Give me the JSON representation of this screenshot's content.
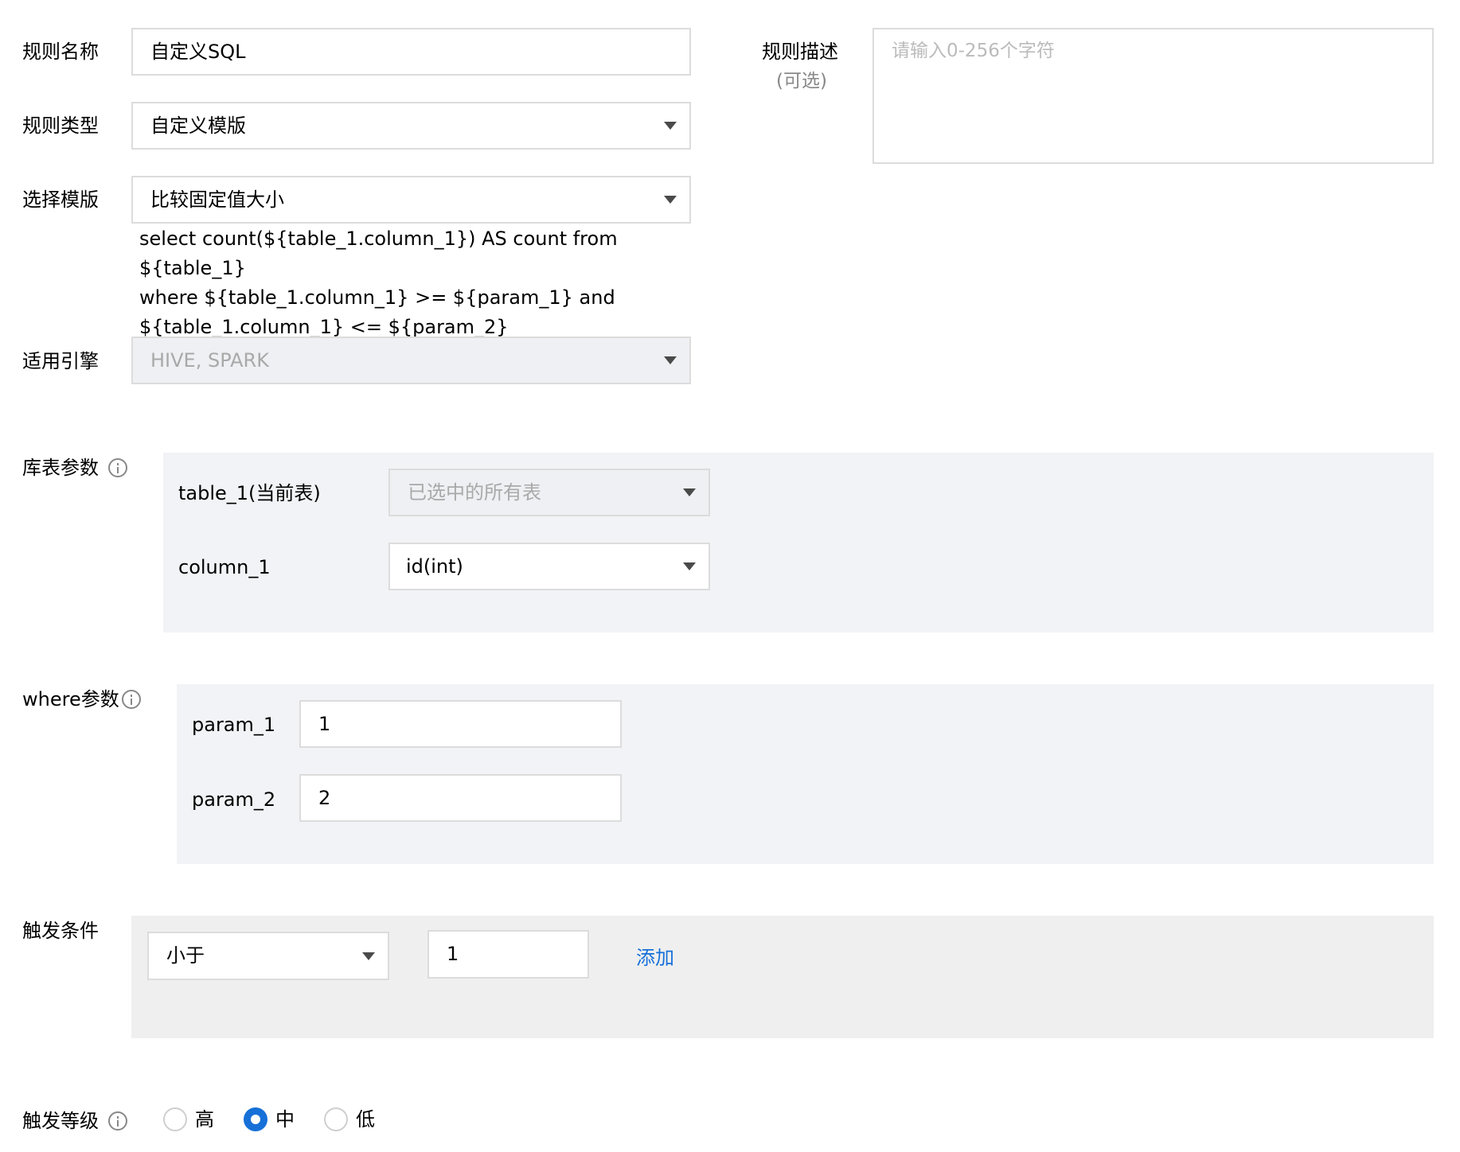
{
  "rule_name": {
    "label": "规则名称",
    "value": "自定义SQL"
  },
  "rule_desc": {
    "label": "规则描述",
    "optional": "(可选)",
    "placeholder": "请输入0-256个字符"
  },
  "rule_type": {
    "label": "规则类型",
    "value": "自定义模版"
  },
  "template": {
    "label": "选择模版",
    "value": "比较固定值大小",
    "sql_lines": [
      "select count(${table_1.column_1}) AS count from ${table_1}",
      "where ${table_1.column_1} >= ${param_1} and",
      "${table_1.column_1} <= ${param_2}"
    ]
  },
  "engine": {
    "label": "适用引擎",
    "value": "HIVE, SPARK"
  },
  "table_params": {
    "label": "库表参数",
    "rows": [
      {
        "name": "table_1(当前表)",
        "value": "已选中的所有表"
      },
      {
        "name": "column_1",
        "value": "id(int)"
      }
    ]
  },
  "where_params": {
    "label": "where参数",
    "rows": [
      {
        "name": "param_1",
        "value": "1"
      },
      {
        "name": "param_2",
        "value": "2"
      }
    ]
  },
  "trigger_condition": {
    "label": "触发条件",
    "operator": "小于",
    "value": "1",
    "add_label": "添加"
  },
  "trigger_level": {
    "label": "触发等级",
    "options": [
      "高",
      "中",
      "低"
    ],
    "selected": "中"
  },
  "colors": {
    "accent": "#1670d8",
    "panel": "#f2f3f6",
    "panel_gray": "#efefef",
    "border": "#dcdcdc"
  }
}
